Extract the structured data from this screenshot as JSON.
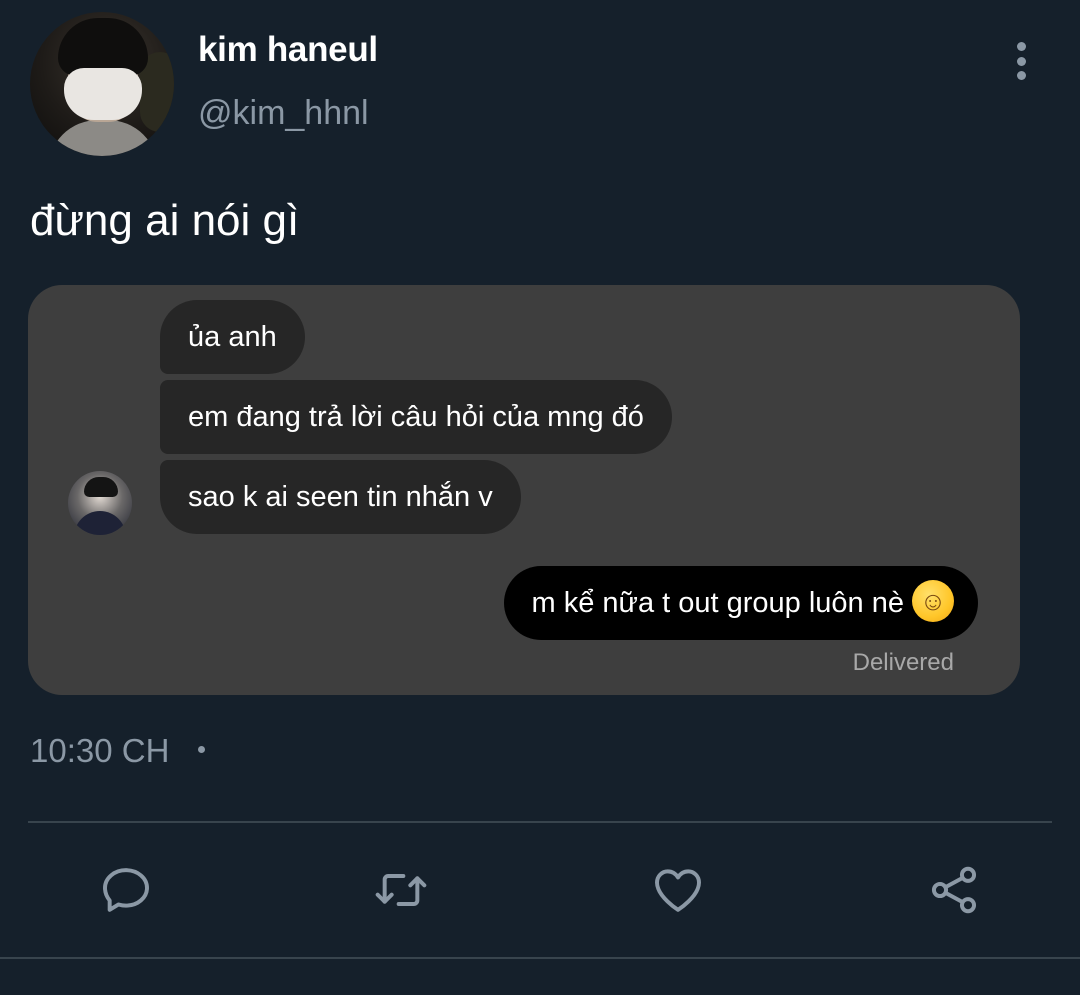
{
  "tweet": {
    "author": {
      "display_name": "kim haneul",
      "handle": "@kim_hhnl"
    },
    "text": "đừng ai nói gì",
    "timestamp": "10:30 CH"
  },
  "chat": {
    "incoming": [
      "ủa anh",
      "em đang trả lời câu hỏi của mng đó",
      "sao k ai seen tin nhắn v"
    ],
    "outgoing": {
      "text": "m kể nữa t out group luôn nè",
      "emoji": "☺"
    },
    "status": "Delivered"
  },
  "actions": {
    "reply_icon": "reply-icon",
    "retweet_icon": "retweet-icon",
    "like_icon": "heart-icon",
    "share_icon": "share-icon"
  },
  "colors": {
    "background": "#15202b",
    "secondary_text": "#8b98a5",
    "divider": "#38444d",
    "chat_panel": "#3e3e3e",
    "incoming_bubble": "#262626",
    "outgoing_bubble": "#000000"
  }
}
